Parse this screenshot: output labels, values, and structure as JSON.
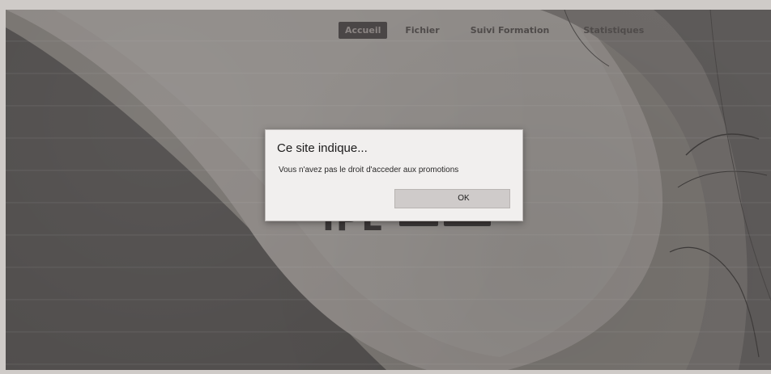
{
  "nav": {
    "items": [
      {
        "label": "Accueil",
        "active": true
      },
      {
        "label": "Fichier",
        "active": false
      },
      {
        "label": "Suivi Formation",
        "active": false
      },
      {
        "label": "Statistiques",
        "active": false
      }
    ]
  },
  "logo": {
    "text": "IPE",
    "tag1": "",
    "tag2": ""
  },
  "dialog": {
    "title": "Ce site indique...",
    "message": "Vous n'avez pas le droit d'acceder aux promotions",
    "ok_label": "OK"
  },
  "colors": {
    "dialog_bg": "#f1efee",
    "nav_active_bg": "#4a4646",
    "background_dark": "#4e4b4a",
    "background_mid": "#7a7674"
  }
}
